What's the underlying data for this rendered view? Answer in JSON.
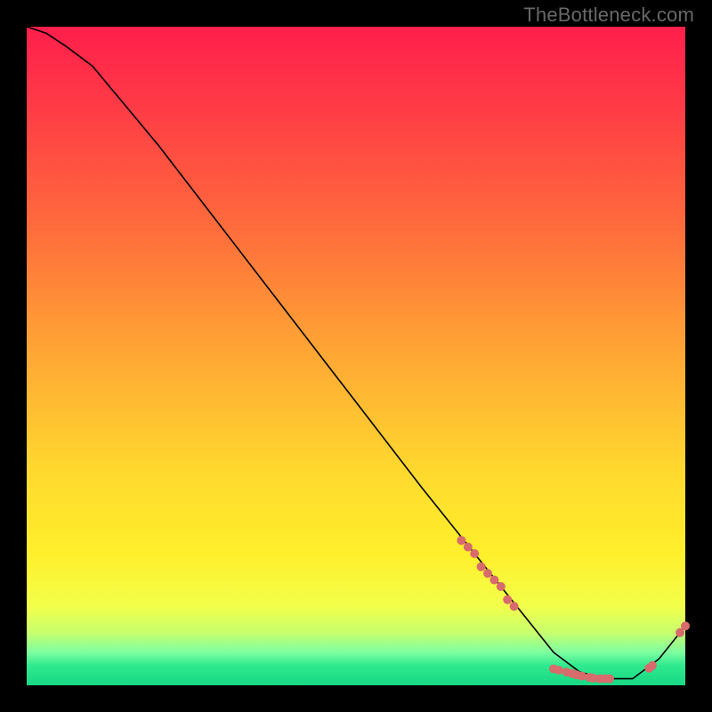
{
  "watermark": "TheBottleneck.com",
  "chart_data": {
    "type": "line",
    "title": "",
    "xlabel": "",
    "ylabel": "",
    "xlim": [
      0,
      100
    ],
    "ylim": [
      0,
      100
    ],
    "grid": false,
    "legend": false,
    "series": [
      {
        "name": "bottleneck-curve",
        "x": [
          0,
          3,
          6,
          10,
          15,
          20,
          30,
          40,
          50,
          60,
          68,
          72,
          76,
          80,
          84,
          88,
          92,
          96,
          100
        ],
        "y": [
          100,
          99,
          97,
          94,
          88,
          82,
          69,
          56,
          43,
          30,
          20,
          15,
          10,
          5,
          2,
          1,
          1,
          4,
          9
        ]
      }
    ],
    "markers": [
      {
        "x": 66,
        "y": 22
      },
      {
        "x": 67,
        "y": 21
      },
      {
        "x": 68,
        "y": 20
      },
      {
        "x": 69,
        "y": 18
      },
      {
        "x": 70,
        "y": 17
      },
      {
        "x": 71,
        "y": 16
      },
      {
        "x": 72,
        "y": 15
      },
      {
        "x": 73,
        "y": 13
      },
      {
        "x": 74,
        "y": 12
      },
      {
        "x": 80,
        "y": 2.5
      },
      {
        "x": 80.8,
        "y": 2.3
      },
      {
        "x": 82,
        "y": 2.0
      },
      {
        "x": 82.8,
        "y": 1.8
      },
      {
        "x": 83.5,
        "y": 1.6
      },
      {
        "x": 84.3,
        "y": 1.4
      },
      {
        "x": 85.4,
        "y": 1.2
      },
      {
        "x": 86.0,
        "y": 1.1
      },
      {
        "x": 87.0,
        "y": 1.0
      },
      {
        "x": 87.8,
        "y": 1.0
      },
      {
        "x": 88.5,
        "y": 1.0
      },
      {
        "x": 94.5,
        "y": 2.6
      },
      {
        "x": 95.0,
        "y": 3.0
      },
      {
        "x": 99.2,
        "y": 8.0
      },
      {
        "x": 100.0,
        "y": 9.0
      }
    ]
  }
}
